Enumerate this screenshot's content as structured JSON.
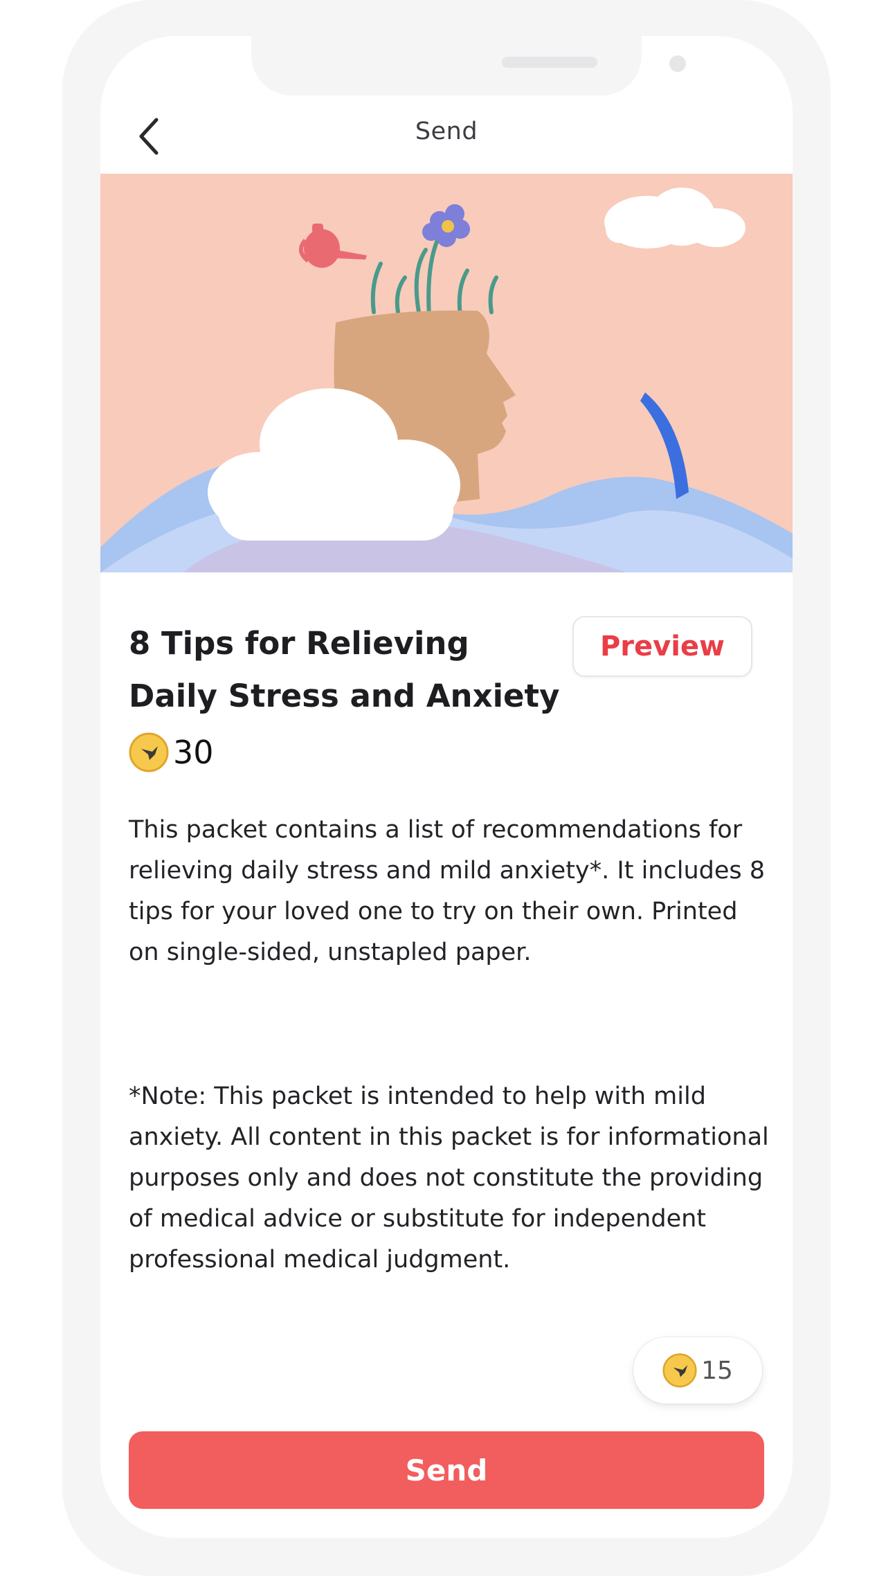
{
  "header": {
    "title": "Send"
  },
  "product": {
    "title_line1": "8 Tips for Relieving",
    "title_line2": "Daily Stress and Anxiety",
    "preview_label": "Preview",
    "price": "30",
    "description": "This packet contains a list of recommendations for relieving daily stress and mild anxiety*. It includes 8 tips for your loved one to try on their own. Printed on single-sided, unstapled paper.",
    "note": "*Note: This packet is intended to help with mild anxiety. All content in this packet is for informational purposes only and does not constitute the providing of medical advice or substitute for independent professional medical judgment."
  },
  "wallet": {
    "balance": "15"
  },
  "actions": {
    "send_label": "Send"
  },
  "icons": {
    "back": "chevron-left-icon",
    "coin": "coin-icon"
  },
  "colors": {
    "accent": "#f25d5d",
    "preview_text": "#ea3d47",
    "hero_bg": "#f8cbbb"
  }
}
